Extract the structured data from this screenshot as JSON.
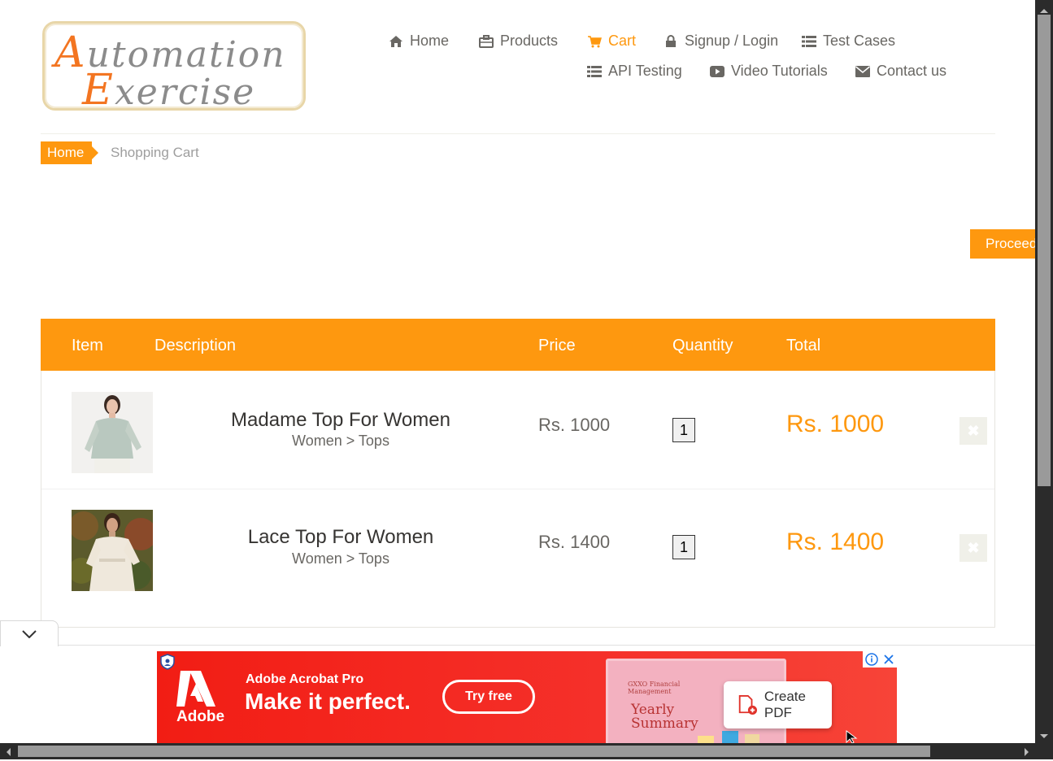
{
  "logo": {
    "line1_cap": "A",
    "line1_rest": "utomation",
    "line2_cap": "E",
    "line2_rest": "xercise"
  },
  "nav": {
    "home": "Home",
    "products": "Products",
    "cart": "Cart",
    "signup": "Signup / Login",
    "test_cases": "Test Cases",
    "api_testing": "API Testing",
    "video_tutorials": "Video Tutorials",
    "contact": "Contact us"
  },
  "breadcrumb": {
    "home": "Home",
    "current": "Shopping Cart"
  },
  "proceed_label": "Proceed",
  "table": {
    "headers": {
      "item": "Item",
      "description": "Description",
      "price": "Price",
      "quantity": "Quantity",
      "total": "Total"
    },
    "rows": [
      {
        "name": "Madame Top For Women",
        "category": "Women > Tops",
        "price": "Rs. 1000",
        "quantity": "1",
        "total": "Rs. 1000"
      },
      {
        "name": "Lace Top For Women",
        "category": "Women > Tops",
        "price": "Rs. 1400",
        "quantity": "1",
        "total": "Rs. 1400"
      }
    ]
  },
  "ad": {
    "brand": "Adobe",
    "product": "Adobe Acrobat Pro",
    "headline": "Make it perfect.",
    "cta": "Try free",
    "card_company": "GXXO Financial Management",
    "card_title": "Yearly Summary",
    "create_pdf": "Create PDF"
  },
  "colors": {
    "accent": "#fe980f",
    "text": "#696763",
    "ad_red": "#f21d14"
  }
}
